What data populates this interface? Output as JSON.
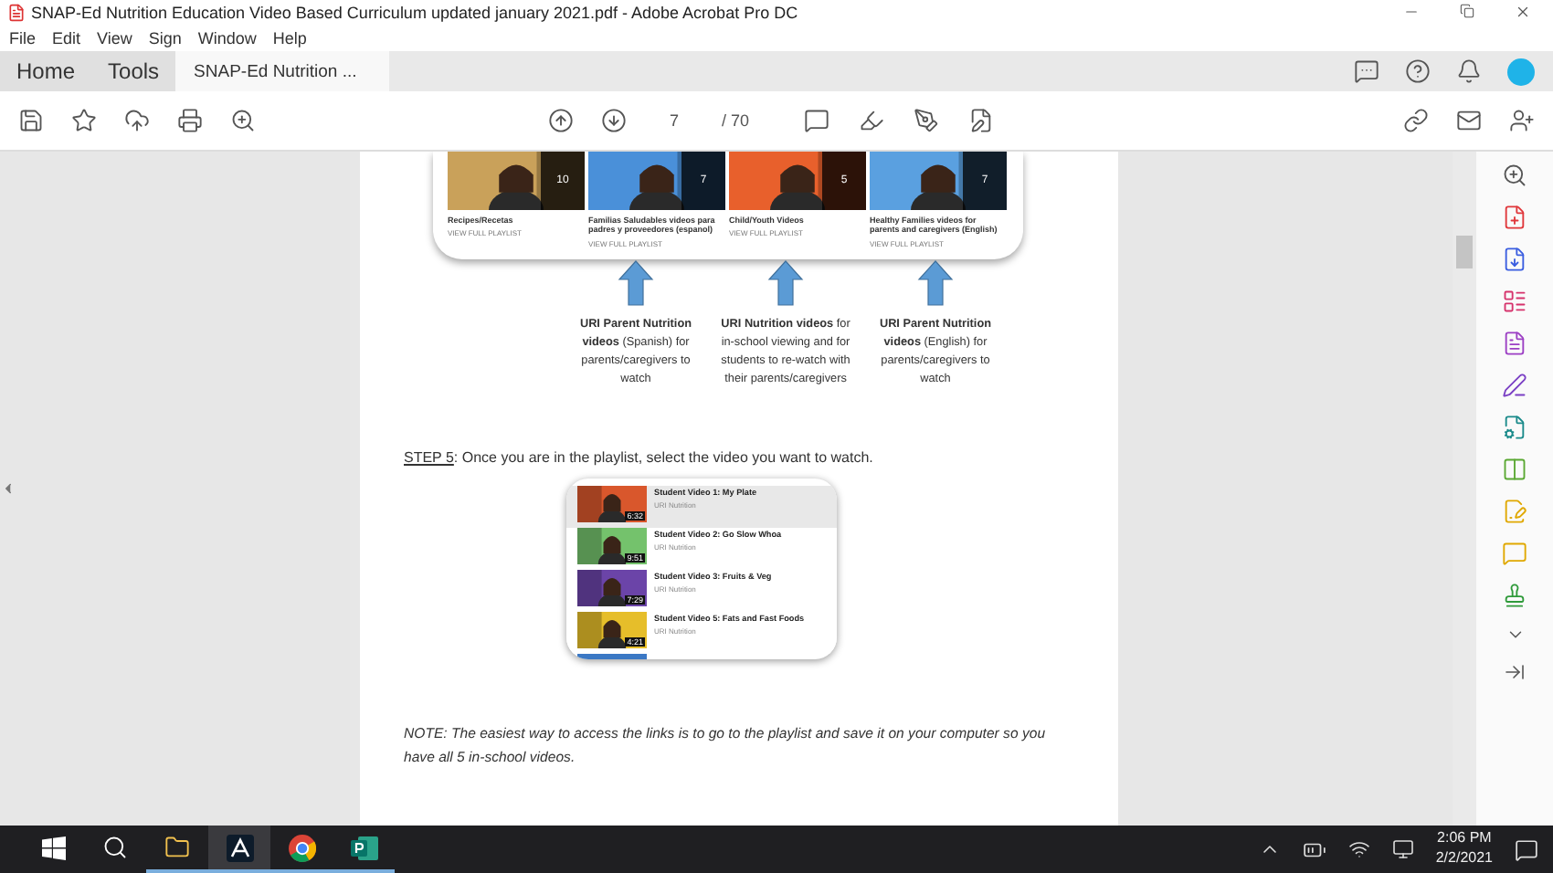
{
  "window": {
    "title": "SNAP-Ed Nutrition Education Video Based Curriculum updated january 2021.pdf - Adobe Acrobat Pro DC"
  },
  "menu": [
    "File",
    "Edit",
    "View",
    "Sign",
    "Window",
    "Help"
  ],
  "tabs": [
    {
      "label": "Home",
      "selected": false
    },
    {
      "label": "Tools",
      "selected": false
    },
    {
      "label": "SNAP-Ed Nutrition ...",
      "selected": true
    }
  ],
  "toolbar": {
    "page_current": "7",
    "page_total": "/ 70"
  },
  "document": {
    "playlists": [
      {
        "title": "Recipes/Recetas",
        "link": "VIEW FULL PLAYLIST",
        "count": "10",
        "color": "#c9a15a"
      },
      {
        "title": "Familias Saludables videos para padres y proveedores (espanol)",
        "link": "VIEW FULL PLAYLIST",
        "count": "7",
        "color": "#4a90d9"
      },
      {
        "title": "Child/Youth Videos",
        "link": "VIEW FULL PLAYLIST",
        "count": "5",
        "color": "#e8602c"
      },
      {
        "title": "Healthy Families videos for parents and caregivers (English)",
        "link": "VIEW FULL PLAYLIST",
        "count": "7",
        "color": "#5aa0e0"
      }
    ],
    "arrow_notes": [
      "**URI Parent Nutrition videos** (Spanish) for parents/caregivers to watch",
      "**URI Nutrition videos** for in-school viewing and for students to re-watch with their parents/caregivers",
      "**URI Parent Nutrition videos** (English) for parents/caregivers to watch"
    ],
    "step": {
      "label": "STEP 5",
      "text": ": Once you are in the playlist, select the video you want to watch."
    },
    "videos": [
      {
        "title": "Student Video 1: My Plate",
        "channel": "URI Nutrition",
        "duration": "6:32",
        "color": "#d9572c",
        "selected": true
      },
      {
        "title": "Student Video 2: Go Slow Whoa",
        "channel": "URI Nutrition",
        "duration": "9:51",
        "color": "#74c26c",
        "selected": false
      },
      {
        "title": "Student Video 3: Fruits & Veg",
        "channel": "URI Nutrition",
        "duration": "7:29",
        "color": "#6b44a8",
        "selected": false
      },
      {
        "title": "Student Video 5: Fats and Fast Foods",
        "channel": "URI Nutrition",
        "duration": "4:21",
        "color": "#e6be2a",
        "selected": false
      }
    ],
    "note": "NOTE: The easiest way to access the links is to go to the playlist and save it on your computer so you have all 5 in-school videos."
  },
  "taskbar": {
    "time": "2:06 PM",
    "date": "2/2/2021"
  }
}
